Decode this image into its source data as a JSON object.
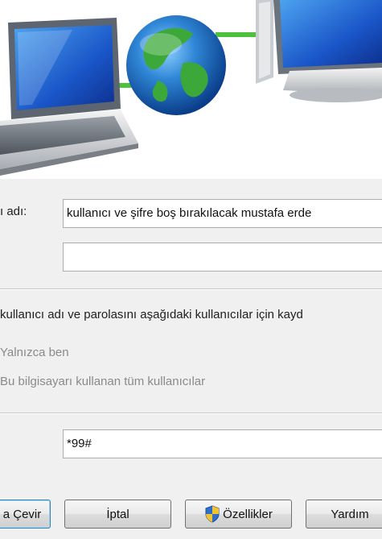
{
  "form": {
    "user_label": "ı adı:",
    "username_value": "kullanıcı ve şifre boş bırakılacak mustafa erde",
    "password_value": "",
    "save_credentials_text": "kullanıcı adı ve parolasını aşağıdaki kullanıcılar için kayd",
    "option_only_me": "Yalnızca ben",
    "option_all_users": "Bu bilgisayarı kullanan tüm kullanıcılar",
    "dial_number_value": "*99#"
  },
  "buttons": {
    "dial": "a Çevir",
    "cancel": "İptal",
    "properties": "Özellikler",
    "help": "Yardım"
  }
}
